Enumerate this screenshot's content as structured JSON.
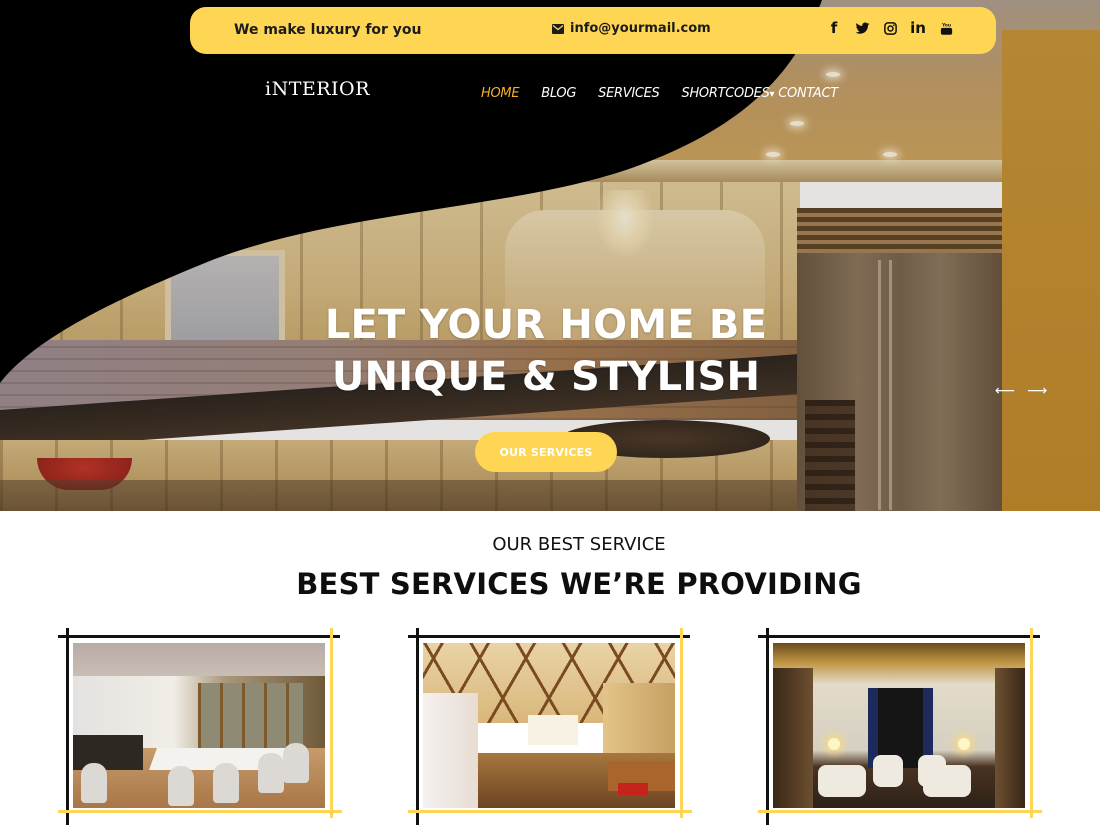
{
  "topbar": {
    "tagline": "We make luxury for you",
    "email_icon": "envelope-icon",
    "email": "info@yourmail.com",
    "socials": [
      {
        "name": "facebook",
        "icon": "facebook-icon",
        "glyph": "f"
      },
      {
        "name": "twitter",
        "icon": "twitter-icon"
      },
      {
        "name": "instagram",
        "icon": "instagram-icon"
      },
      {
        "name": "linkedin",
        "icon": "linkedin-icon",
        "glyph": "in"
      },
      {
        "name": "youtube",
        "icon": "youtube-icon"
      }
    ]
  },
  "header": {
    "logo": "iNTERIOR",
    "nav": [
      {
        "label": "HOME",
        "active": true
      },
      {
        "label": "BLOG",
        "active": false
      },
      {
        "label": "SERVICES",
        "active": false
      },
      {
        "label": "SHORTCODES",
        "active": false,
        "has_dropdown": true,
        "caret": "▾"
      },
      {
        "label": "CONTACT",
        "active": false
      }
    ]
  },
  "hero": {
    "title_line1": "LET YOUR HOME BE",
    "title_line2": "UNIQUE & STYLISH",
    "button_label": "OUR SERVICES",
    "prev_arrow": "⟵",
    "next_arrow": "⟶"
  },
  "services": {
    "subtitle": "OUR BEST SERVICE",
    "title": "BEST SERVICES WE’RE PROVIDING",
    "cards": [
      {
        "image": "modern-dining-room-photo"
      },
      {
        "image": "coffered-ceiling-hall-photo"
      },
      {
        "image": "classic-living-room-photo"
      }
    ]
  },
  "colors": {
    "accent_yellow": "#fed653",
    "nav_active": "#f5b324",
    "dark": "#000000",
    "text": "#111111"
  }
}
